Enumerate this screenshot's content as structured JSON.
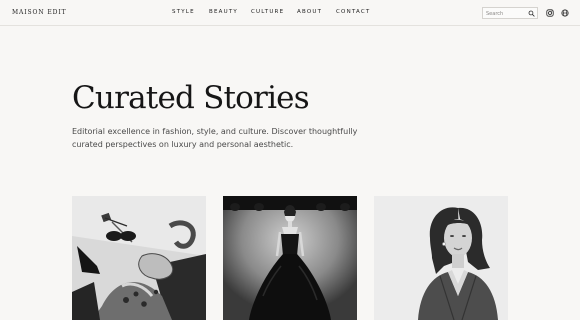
{
  "brand": {
    "logo": "MAISON EDIT"
  },
  "nav": {
    "items": [
      {
        "label": "STYLE"
      },
      {
        "label": "BEAUTY"
      },
      {
        "label": "CULTURE"
      },
      {
        "label": "ABOUT"
      },
      {
        "label": "CONTACT"
      }
    ]
  },
  "search": {
    "placeholder": "Search",
    "value": ""
  },
  "icons": {
    "search": "search-icon",
    "instagram": "instagram-icon",
    "globe": "globe-icon"
  },
  "hero": {
    "title": "Curated Stories",
    "subtitle": "Editorial excellence in fashion, style, and culture. Discover thoughtfully curated perspectives on luxury and personal aesthetic."
  },
  "cards": [
    {
      "subject": "accessories still life"
    },
    {
      "subject": "model in black gown on runway"
    },
    {
      "subject": "portrait of woman in blazer"
    }
  ],
  "colors": {
    "background": "#f8f7f5",
    "text": "#1a1a1a",
    "muted": "#4a4a4a",
    "border": "#e4e2de"
  }
}
